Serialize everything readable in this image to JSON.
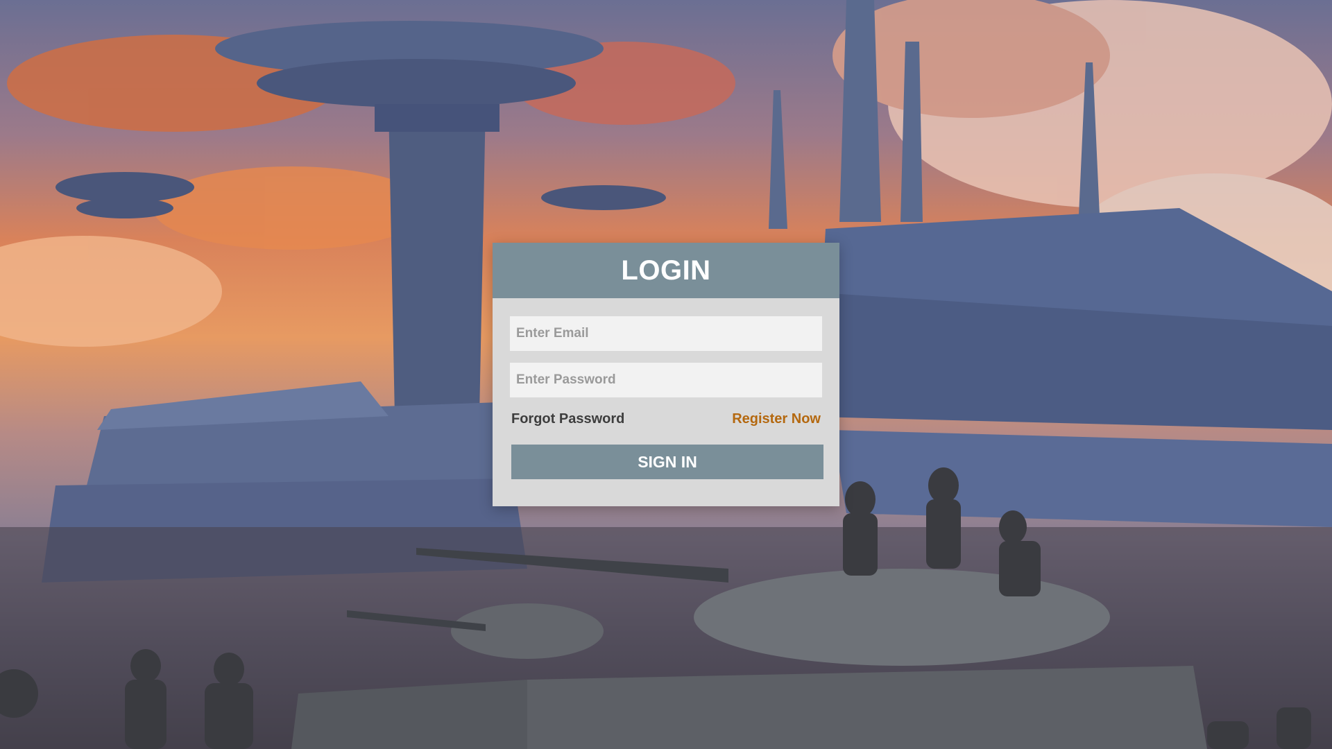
{
  "background": {
    "description_icon": "sci-fi-city-with-tanks-image",
    "colors": {
      "sky_orange": "#e79a62",
      "sky_purple": "#6b6f93",
      "structure_blue": "#4f5d80",
      "ground_dark": "#3c3a44"
    }
  },
  "login": {
    "title": "LOGIN",
    "email_placeholder": "Enter Email",
    "email_value": "",
    "password_placeholder": "Enter Password",
    "password_value": "",
    "forgot_label": "Forgot Password",
    "register_label": "Register Now",
    "signin_label": "SIGN IN",
    "colors": {
      "header": "#7a8f99",
      "card": "#d9d9d9",
      "register_link": "#b4680f"
    }
  }
}
